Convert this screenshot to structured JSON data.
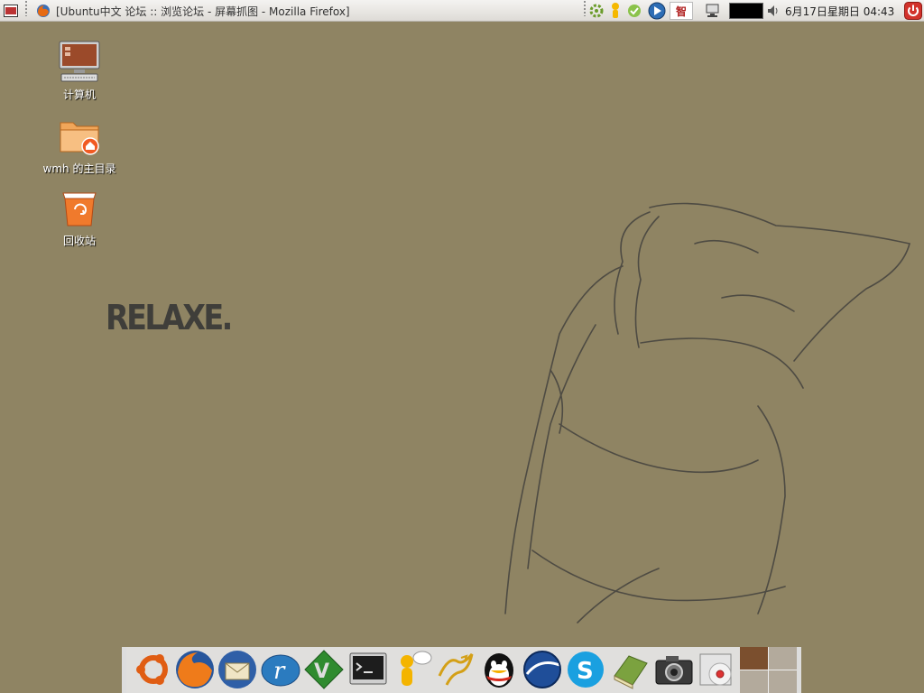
{
  "top_panel": {
    "task": {
      "title": "[Ubuntu中文 论坛 :: 浏览论坛 - 屏幕抓图 - Mozilla Firefox]"
    },
    "tray": {
      "ime_label": "智"
    },
    "clock": "6月17日星期日 04:43"
  },
  "desktop": {
    "icons": [
      {
        "label": "计算机",
        "icon": "computer-icon"
      },
      {
        "label": "wmh 的主目录",
        "icon": "home-folder-icon"
      },
      {
        "label": "回收站",
        "icon": "trash-icon"
      }
    ],
    "wallpaper_text": "RELAXE."
  },
  "dock": {
    "items": [
      {
        "icon": "ubuntu-icon"
      },
      {
        "icon": "firefox-icon"
      },
      {
        "icon": "thunderbird-icon"
      },
      {
        "icon": "realplayer-icon"
      },
      {
        "icon": "vim-icon"
      },
      {
        "icon": "terminal-icon"
      },
      {
        "icon": "pidgin-icon"
      },
      {
        "icon": "stardict-icon"
      },
      {
        "icon": "qq-icon"
      },
      {
        "icon": "google-earth-icon"
      },
      {
        "icon": "skype-icon"
      },
      {
        "icon": "dictionary-book-icon"
      },
      {
        "icon": "camera-icon"
      },
      {
        "icon": "cd-burner-icon"
      }
    ],
    "pager": {
      "workspaces": 4,
      "active": 1
    }
  },
  "colors": {
    "desktop_bg": "#8f8463",
    "panel_bg": "#eceae6",
    "wallpaper_text": "#3f3e3a"
  }
}
